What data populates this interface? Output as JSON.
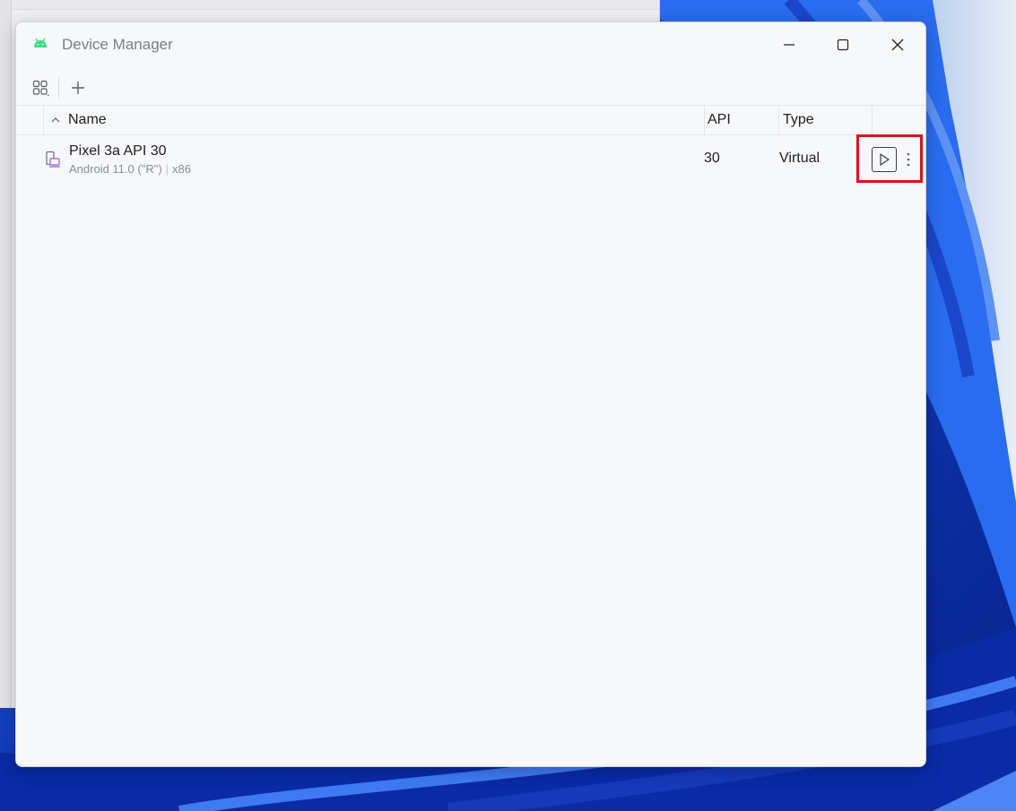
{
  "window": {
    "title": "Device Manager"
  },
  "icons": {
    "app": "android-icon",
    "minimize": "minimize-icon",
    "maximize": "maximize-icon",
    "close": "close-icon",
    "view_toggle": "grid-view-icon",
    "add": "plus-icon",
    "sort": "chevron-up-icon",
    "device": "virtual-device-icon",
    "launch": "play-icon",
    "more": "more-vertical-icon"
  },
  "table": {
    "columns": {
      "name": "Name",
      "api": "API",
      "type": "Type"
    },
    "rows": [
      {
        "name": "Pixel 3a API 30",
        "android_version": "Android 11.0 (\"R\")",
        "arch": "x86",
        "api": "30",
        "type": "Virtual"
      }
    ]
  },
  "colors": {
    "android_green": "#3ddc84",
    "device_icon": "#9b59d0",
    "highlight": "#e0101a",
    "wallpaper_blue": "#0b2f8a"
  }
}
